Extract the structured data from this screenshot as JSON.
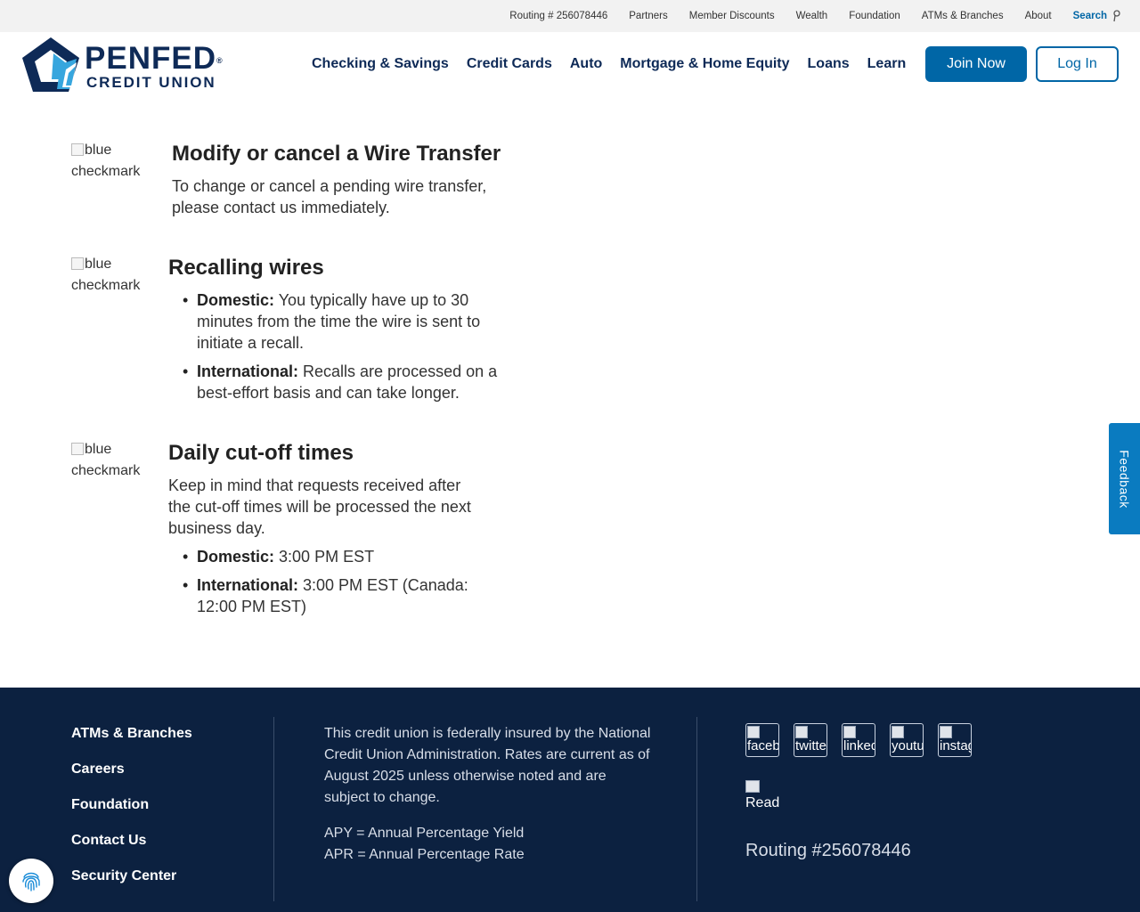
{
  "utility_nav": {
    "items": [
      "Routing # 256078446",
      "Partners",
      "Member Discounts",
      "Wealth",
      "Foundation",
      "ATMs & Branches",
      "About"
    ],
    "search_label": "Search"
  },
  "logo": {
    "name": "PENFED",
    "registered": "®",
    "subtitle": "CREDIT UNION"
  },
  "main_nav": {
    "items": [
      "Checking & Savings",
      "Credit Cards",
      "Auto",
      "Mortgage & Home Equity",
      "Loans",
      "Learn"
    ],
    "join_label": "Join Now",
    "login_label": "Log In"
  },
  "checkmark_alt": "blue checkmark",
  "sections": {
    "modify": {
      "title": "Modify or cancel a Wire Transfer",
      "text": "To change or cancel a pending wire transfer, please contact us immediately."
    },
    "recall": {
      "title": "Recalling wires",
      "bullets": [
        {
          "label": "Domestic:",
          "text": " You typically have up to 30 minutes from the time the wire is sent to initiate a recall."
        },
        {
          "label": "International:",
          "text": " Recalls are processed on a best-effort basis and can take longer."
        }
      ]
    },
    "cutoff": {
      "title": "Daily cut-off times",
      "text": "Keep in mind that requests received after the cut-off times will be processed the next business day.",
      "bullets": [
        {
          "label": "Domestic:",
          "text": " 3:00 PM EST"
        },
        {
          "label": "International:",
          "text": " 3:00 PM EST (Canada: 12:00 PM EST)"
        }
      ]
    }
  },
  "feedback_label": "Feedback",
  "footer": {
    "links": [
      "ATMs & Branches",
      "Careers",
      "Foundation",
      "Contact Us",
      "Security Center"
    ],
    "disclosure": "This credit union is federally insured by the National Credit Union Administration. Rates are current as of August 2025 unless otherwise noted and are subject to change.",
    "apy": "APY = Annual Percentage Yield",
    "apr": "APR = Annual Percentage Rate",
    "social_alts": [
      "facebook",
      "twitter",
      "linkedin",
      "youtube",
      "instagram"
    ],
    "read_alt": "Read",
    "routing": "Routing #256078446"
  },
  "colors": {
    "navy": "#0e2a57",
    "brand_blue": "#0066a6",
    "feedback_blue": "#0a7bc0",
    "footer_bg": "#0c2140",
    "logo_light_blue": "#37a6de"
  }
}
